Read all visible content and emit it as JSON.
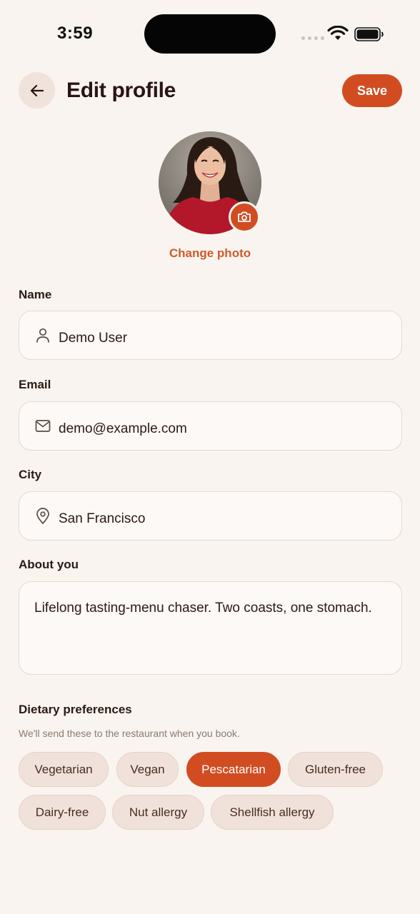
{
  "status_bar": {
    "time": "3:59"
  },
  "header": {
    "title": "Edit profile",
    "save_label": "Save"
  },
  "avatar": {
    "change_photo_label": "Change photo"
  },
  "fields": {
    "name": {
      "label": "Name",
      "value": "Demo User",
      "icon": "person-icon"
    },
    "email": {
      "label": "Email",
      "value": "demo@example.com",
      "icon": "mail-icon"
    },
    "city": {
      "label": "City",
      "value": "San Francisco",
      "icon": "location-pin-icon"
    },
    "about": {
      "label": "About you",
      "value": "Lifelong tasting-menu chaser. Two coasts, one stomach."
    }
  },
  "dietary": {
    "title": "Dietary preferences",
    "subtitle": "We'll send these to the restaurant when you book.",
    "chips": [
      {
        "label": "Vegetarian",
        "selected": false
      },
      {
        "label": "Vegan",
        "selected": false
      },
      {
        "label": "Pescatarian",
        "selected": true
      },
      {
        "label": "Gluten-free",
        "selected": false
      },
      {
        "label": "Dairy-free",
        "selected": false
      },
      {
        "label": "Nut allergy",
        "selected": false
      },
      {
        "label": "Shellfish allergy",
        "selected": false
      }
    ]
  },
  "colors": {
    "accent": "#d24c22",
    "background": "#f9f4ef",
    "chip": "#f0e2da",
    "text": "#2b1a14"
  }
}
